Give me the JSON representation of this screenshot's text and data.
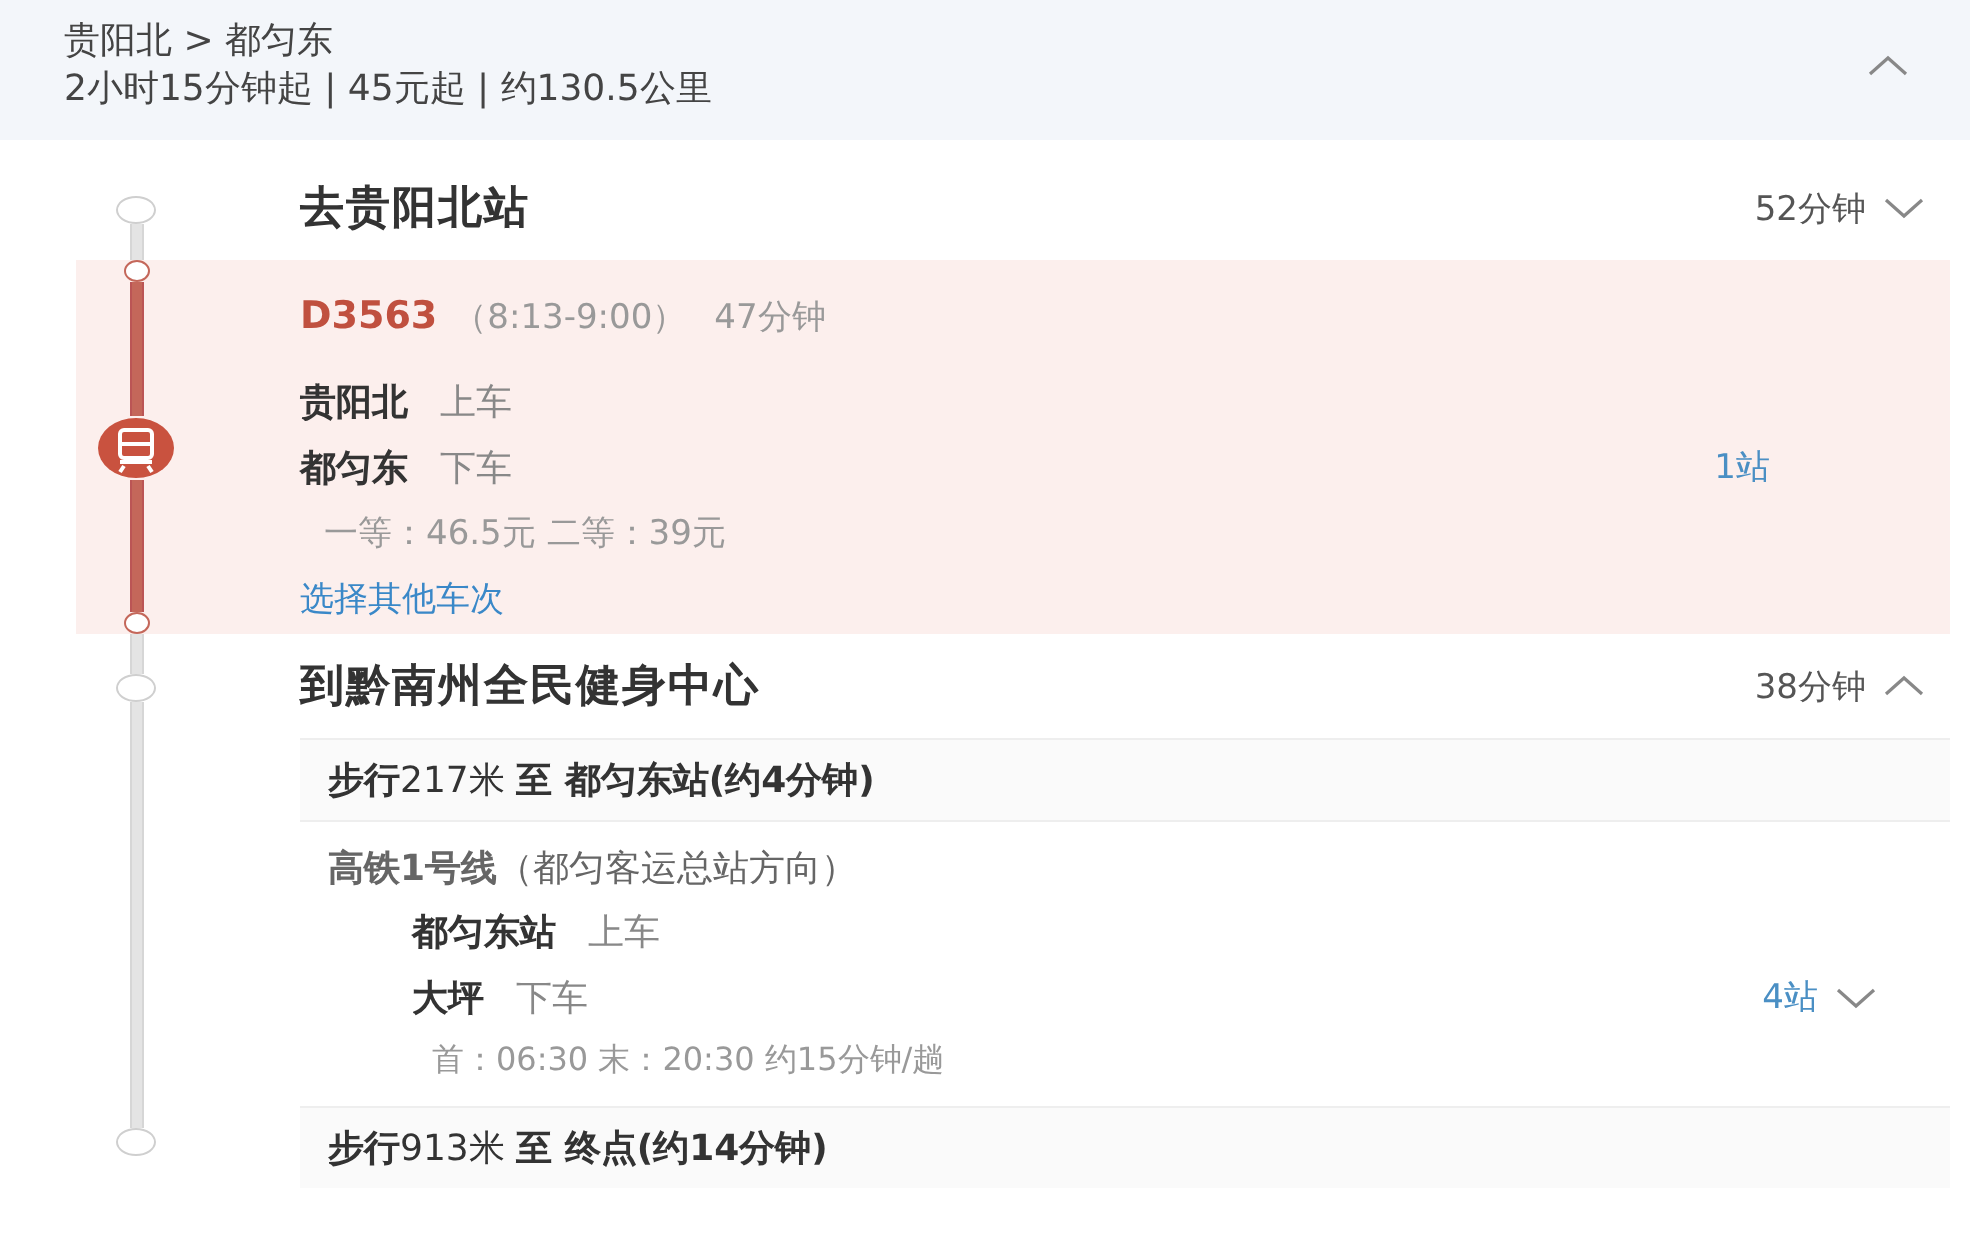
{
  "header": {
    "route": "贵阳北 > 都匀东",
    "summary": "2小时15分钟起 | 45元起 | 约130.5公里",
    "expanded": true
  },
  "segments": [
    {
      "kind": "group",
      "title": "去贵阳北站",
      "duration": "52分钟",
      "expanded": false
    },
    {
      "kind": "train",
      "train_no": "D3563",
      "time": "（8:13-9:00）",
      "duration": "47分钟",
      "stops": [
        {
          "station": "贵阳北",
          "action": "上车"
        },
        {
          "station": "都匀东",
          "action": "下车"
        }
      ],
      "stop_count": "1站",
      "fares": "一等：46.5元 二等：39元",
      "link": "选择其他车次"
    },
    {
      "kind": "group",
      "title": "到黔南州全民健身中心",
      "duration": "38分钟",
      "expanded": true,
      "steps": [
        {
          "kind": "walk",
          "text": "**步行**217米 **至 都匀东站(约4分钟)**"
        },
        {
          "kind": "transit",
          "line": "**高铁1号线**（都匀客运总站方向）",
          "stops": [
            {
              "station": "都匀东站",
              "action": "上车"
            },
            {
              "station": "大坪",
              "action": "下车"
            }
          ],
          "stop_count": "4站",
          "expanded": false,
          "schedule": "首：06:30 末：20:30 约15分钟/趟"
        },
        {
          "kind": "walk",
          "text": "**步行**913米 **至 终点(约14分钟)**"
        }
      ]
    }
  ]
}
